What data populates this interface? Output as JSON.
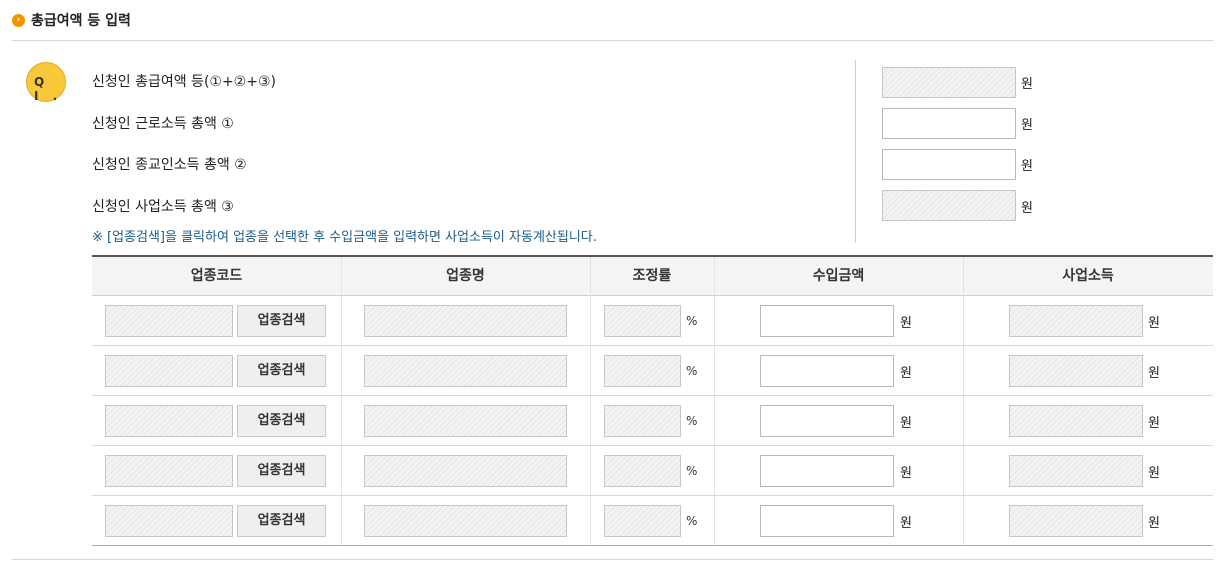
{
  "section": {
    "title": "총급여액 등 입력",
    "bullet": "›"
  },
  "badge": {
    "text": "Q I ."
  },
  "summary": [
    {
      "label": "신청인 총급여액 등(①+②+③)",
      "unit": "원",
      "readonly": true,
      "value": ""
    },
    {
      "label": "신청인 근로소득 총액 ①",
      "unit": "원",
      "readonly": false,
      "value": ""
    },
    {
      "label": "신청인 종교인소득 총액 ②",
      "unit": "원",
      "readonly": false,
      "value": ""
    },
    {
      "label": "신청인 사업소득 총액 ③",
      "unit": "원",
      "readonly": true,
      "value": ""
    }
  ],
  "notice": "※ [업종검색]을 클릭하여 업종을 선택한 후 수입금액을 입력하면 사업소득이 자동계산됩니다.",
  "table": {
    "headers": [
      "업종코드",
      "업종명",
      "조정률",
      "수입금액",
      "사업소득"
    ],
    "search_button": "업종검색",
    "percent": "%",
    "unit": "원",
    "rows": [
      {
        "code": "",
        "name": "",
        "rate": "",
        "income": "",
        "business_income": ""
      },
      {
        "code": "",
        "name": "",
        "rate": "",
        "income": "",
        "business_income": ""
      },
      {
        "code": "",
        "name": "",
        "rate": "",
        "income": "",
        "business_income": ""
      },
      {
        "code": "",
        "name": "",
        "rate": "",
        "income": "",
        "business_income": ""
      },
      {
        "code": "",
        "name": "",
        "rate": "",
        "income": "",
        "business_income": ""
      }
    ]
  }
}
